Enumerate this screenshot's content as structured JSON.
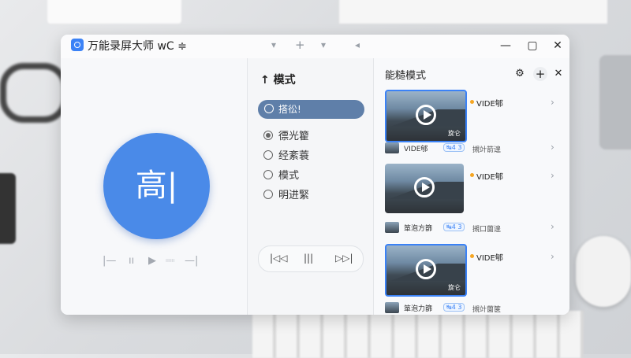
{
  "app": {
    "title": "万能录屏大师 wC ≑",
    "toolbar_icons": [
      "▾",
      "+",
      "▾",
      "◂"
    ],
    "window_controls": {
      "minimize": "—",
      "maximize": "▢",
      "close": "✕"
    }
  },
  "left_panel": {
    "circle_text": "高|",
    "controls": [
      "|—",
      "ıı",
      "▶",
      "—|"
    ],
    "small_label": "ıııııı"
  },
  "middle_panel": {
    "title": "↑ 模式",
    "search_text": "搭彸!",
    "options": [
      {
        "label": "徱光籊",
        "checked": true
      },
      {
        "label": "经紊蓑",
        "checked": false
      },
      {
        "label": "模式",
        "checked": false
      },
      {
        "label": "明进緊",
        "checked": false
      }
    ],
    "media_controls": {
      "prev": "|◁◁",
      "pause": "|||",
      "next": "▷▷|"
    }
  },
  "right_panel": {
    "title": "能糙模式",
    "icons": {
      "settings": "⚙",
      "add": "+",
      "close": "✕"
    },
    "videos": [
      {
        "title": "VIDE郇",
        "tag": "旋仑",
        "selected": true
      },
      {
        "title": "VIDE郇",
        "tag": "",
        "selected": false
      },
      {
        "title": "VIDE郇",
        "tag": "旋仑",
        "selected": true
      }
    ],
    "rows": [
      {
        "label": "VIDE郇",
        "badge": "↹4 3",
        "text": "摫竍箭遑"
      },
      {
        "label": "箪泡方篩",
        "badge": "↹4 3",
        "text": "摫口薗遑"
      },
      {
        "label": "箪泡力篩",
        "badge": "↹4 3",
        "text": "摫竍薗箧"
      }
    ],
    "accent_color": "#3b82f6",
    "dot_color": "#f5a623"
  }
}
